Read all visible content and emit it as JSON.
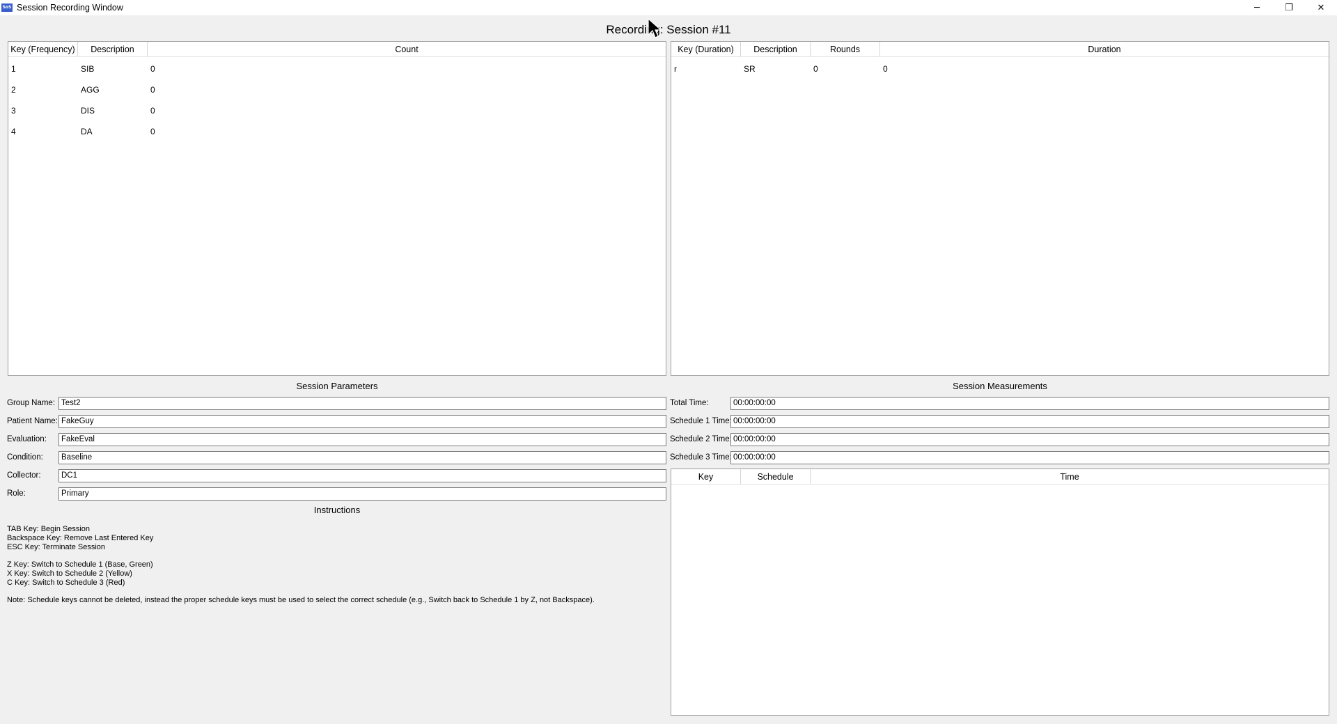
{
  "window": {
    "title": "Session Recording Window",
    "app_icon_text": "SoS",
    "minimize_glyph": "─",
    "maximize_glyph": "❐",
    "close_glyph": "✕"
  },
  "heading": "Recording: Session #11",
  "frequency_table": {
    "headers": [
      "Key (Frequency)",
      "Description",
      "Count"
    ],
    "rows": [
      {
        "key": "1",
        "description": "SIB",
        "count": "0"
      },
      {
        "key": "2",
        "description": "AGG",
        "count": "0"
      },
      {
        "key": "3",
        "description": "DIS",
        "count": "0"
      },
      {
        "key": "4",
        "description": "DA",
        "count": "0"
      }
    ]
  },
  "duration_table": {
    "headers": [
      "Key (Duration)",
      "Description",
      "Rounds",
      "Duration"
    ],
    "rows": [
      {
        "key": "r",
        "description": "SR",
        "rounds": "0",
        "duration": "0"
      }
    ]
  },
  "session_parameters": {
    "title": "Session Parameters",
    "fields": [
      {
        "label": "Group Name:",
        "value": "Test2"
      },
      {
        "label": "Patient Name:",
        "value": "FakeGuy"
      },
      {
        "label": "Evaluation:",
        "value": "FakeEval"
      },
      {
        "label": "Condition:",
        "value": "Baseline"
      },
      {
        "label": "Collector:",
        "value": "DC1"
      },
      {
        "label": "Role:",
        "value": "Primary"
      }
    ]
  },
  "session_measurements": {
    "title": "Session Measurements",
    "fields": [
      {
        "label": "Total Time:",
        "value": "00:00:00:00"
      },
      {
        "label": "Schedule 1 Time:",
        "value": "00:00:00:00"
      },
      {
        "label": "Schedule 2 Time:",
        "value": "00:00:00:00"
      },
      {
        "label": "Schedule 3 Time:",
        "value": "00:00:00:00"
      }
    ]
  },
  "schedule_table": {
    "headers": [
      "Key",
      "Schedule",
      "Time"
    ]
  },
  "instructions": {
    "title": "Instructions",
    "lines": [
      "TAB Key: Begin Session",
      "Backspace Key: Remove Last Entered Key",
      "ESC Key: Terminate Session",
      "Z Key: Switch to Schedule 1 (Base, Green)",
      "X Key: Switch to Schedule 2 (Yellow)",
      "C Key: Switch to Schedule 3 (Red)",
      "Note: Schedule keys cannot be deleted, instead the proper schedule keys must be used to select the correct schedule (e.g., Switch back to Schedule 1 by Z, not Backspace)."
    ]
  },
  "icons": {
    "app": "app-icon",
    "cursor": "mouse-cursor-icon"
  }
}
